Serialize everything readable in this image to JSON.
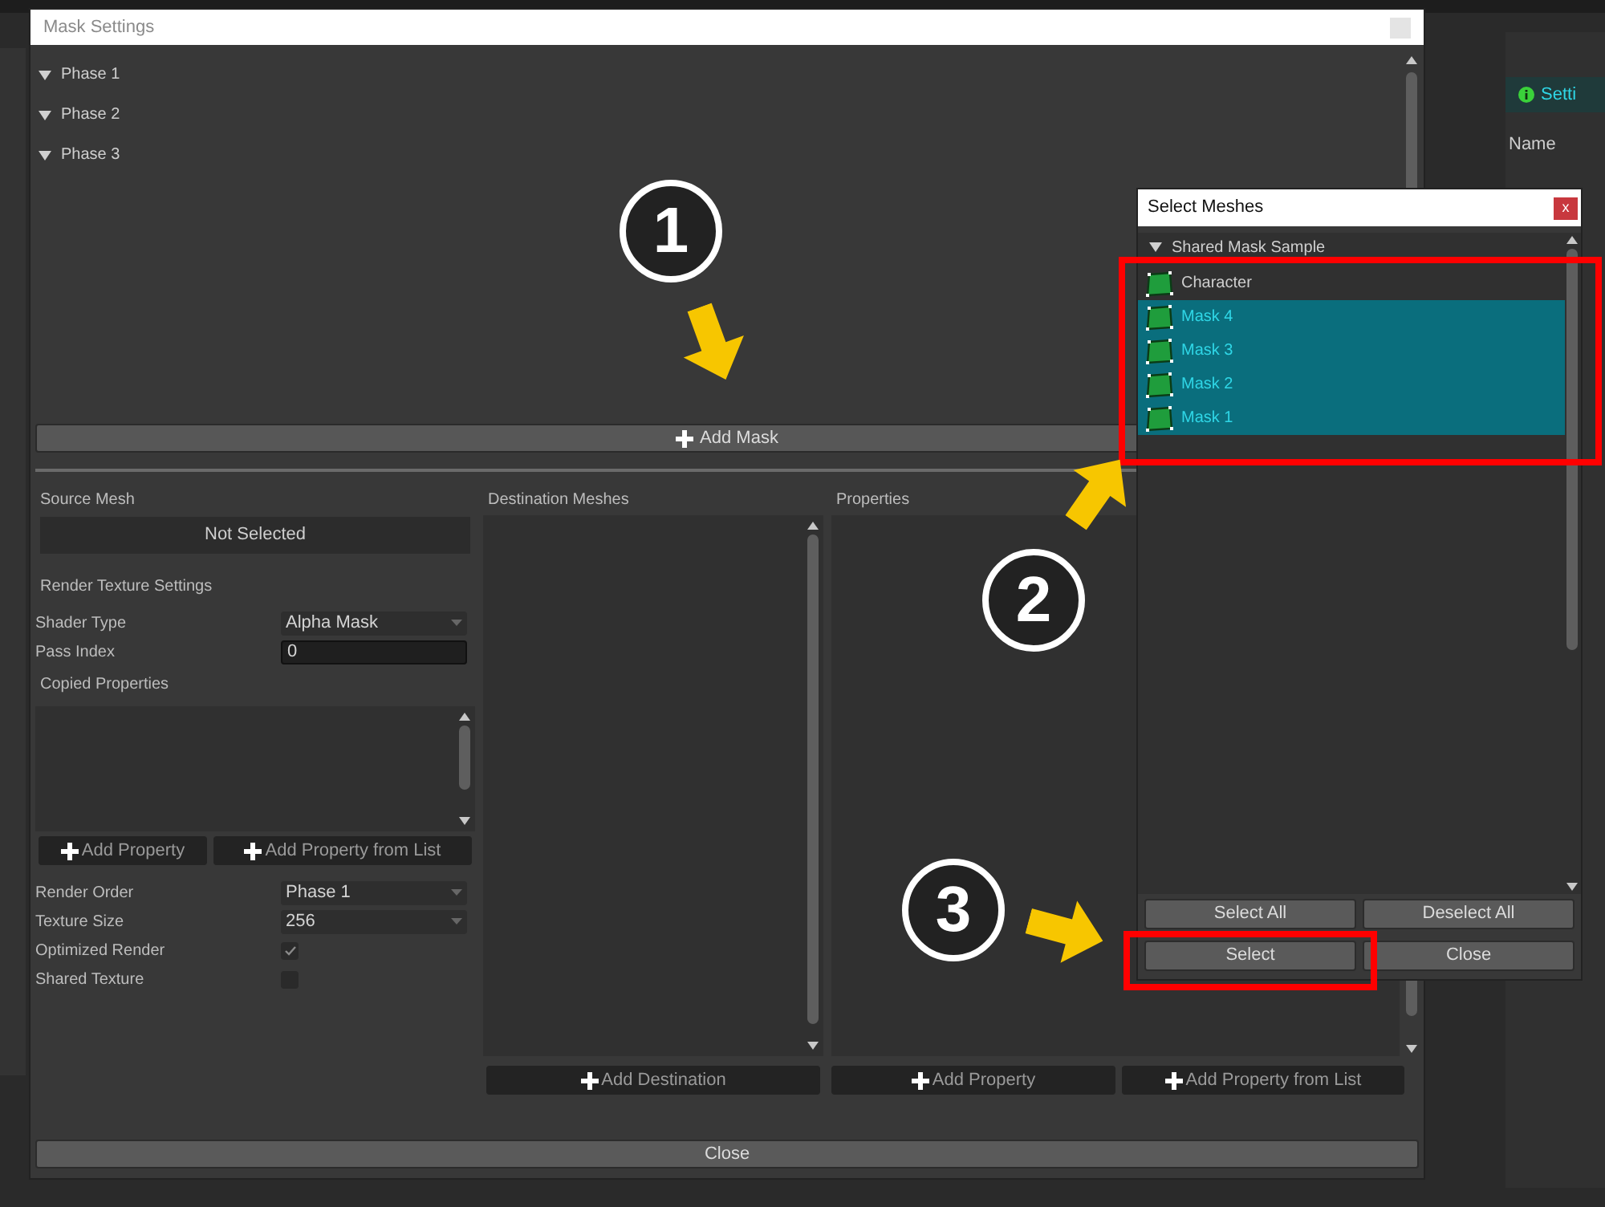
{
  "mask_settings": {
    "title": "Mask Settings",
    "phases": [
      {
        "label": "Phase 1",
        "expanded": true
      },
      {
        "label": "Phase 2",
        "expanded": true
      },
      {
        "label": "Phase 3",
        "expanded": true
      }
    ],
    "add_mask_button": "Add Mask",
    "source_mesh": {
      "heading": "Source Mesh",
      "value": "Not Selected"
    },
    "render_texture_settings": {
      "heading": "Render Texture Settings",
      "fields": [
        {
          "kind": "dropdown",
          "label": "Shader Type",
          "value": "Alpha Mask"
        },
        {
          "kind": "input",
          "label": "Pass Index",
          "value": "0"
        }
      ]
    },
    "copied_properties": {
      "heading": "Copied Properties",
      "buttons": [
        "Add Property",
        "Add Property from List"
      ]
    },
    "options": [
      {
        "kind": "dropdown",
        "label": "Render Order",
        "value": "Phase 1"
      },
      {
        "kind": "dropdown",
        "label": "Texture Size",
        "value": "256"
      },
      {
        "kind": "checkbox",
        "label": "Optimized Render",
        "checked": true
      },
      {
        "kind": "checkbox",
        "label": "Shared Texture",
        "checked": false
      }
    ],
    "destination_meshes": {
      "heading": "Destination Meshes",
      "buttons": [
        "Add Destination"
      ]
    },
    "properties": {
      "heading": "Properties",
      "buttons": [
        "Add Property",
        "Add Property from List"
      ]
    },
    "close_button": "Close"
  },
  "select_meshes": {
    "title": "Select Meshes",
    "close_glyph": "x",
    "group": "Shared Mask Sample",
    "meshes": [
      {
        "label": "Character",
        "selected": false
      },
      {
        "label": "Mask 4",
        "selected": true
      },
      {
        "label": "Mask 3",
        "selected": true
      },
      {
        "label": "Mask 2",
        "selected": true
      },
      {
        "label": "Mask 1",
        "selected": true
      }
    ],
    "buttons": [
      "Select All",
      "Deselect All",
      "Select",
      "Close"
    ]
  },
  "annotations": [
    {
      "number": "1"
    },
    {
      "number": "2"
    },
    {
      "number": "3"
    }
  ],
  "side_panel": {
    "tab": "Setti",
    "column": "Name"
  }
}
